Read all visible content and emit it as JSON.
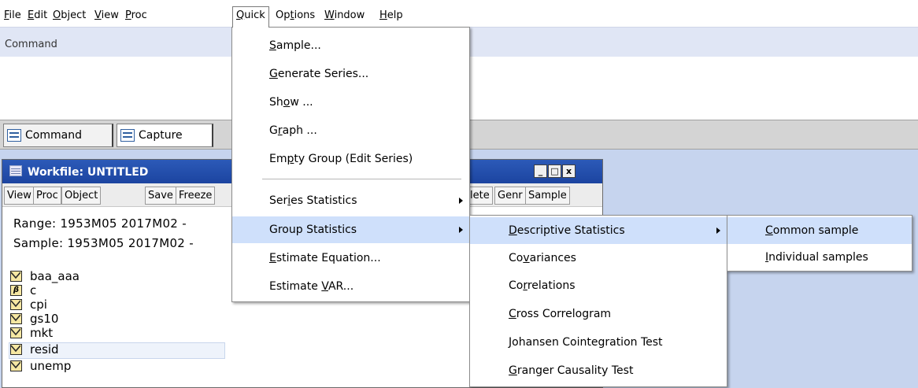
{
  "menubar": {
    "items": [
      {
        "pre": "",
        "u": "F",
        "post": "ile"
      },
      {
        "pre": "",
        "u": "E",
        "post": "dit"
      },
      {
        "pre": "",
        "u": "O",
        "post": "bject"
      },
      {
        "pre": "",
        "u": "V",
        "post": "iew"
      },
      {
        "pre": "",
        "u": "P",
        "post": "roc"
      },
      {
        "pre": "",
        "u": "Q",
        "post": "uick"
      },
      {
        "pre": "Op",
        "u": "t",
        "post": "ions"
      },
      {
        "pre": "",
        "u": "W",
        "post": "indow"
      },
      {
        "pre": "",
        "u": "H",
        "post": "elp"
      }
    ]
  },
  "command_bar": {
    "label": "Command"
  },
  "tabs": {
    "command": "Command",
    "capture": "Capture"
  },
  "workfile": {
    "title": "Workfile: UNTITLED",
    "window_buttons": {
      "minimize": "_",
      "maximize": "□",
      "close": "x"
    },
    "toolbar": [
      "View",
      "Proc",
      "Object",
      "Save",
      "Freeze"
    ],
    "toolbar_right": [
      "lete",
      "Genr",
      "Sample"
    ],
    "range": "Range:  1953M05 2017M02  -",
    "sample": "Sample: 1953M05 2017M02  -",
    "items": [
      {
        "name": "baa_aaa",
        "icon": "series-icon"
      },
      {
        "name": "c",
        "icon": "coefficient-icon"
      },
      {
        "name": "cpi",
        "icon": "series-icon"
      },
      {
        "name": "gs10",
        "icon": "series-icon"
      },
      {
        "name": "mkt",
        "icon": "series-icon"
      },
      {
        "name": "resid",
        "icon": "series-icon"
      },
      {
        "name": "unemp",
        "icon": "series-icon"
      }
    ],
    "coef_icon_glyph": "β"
  },
  "quick_menu": {
    "items": [
      {
        "pre": "",
        "u": "S",
        "post": "ample..."
      },
      {
        "pre": "",
        "u": "G",
        "post": "enerate Series..."
      },
      {
        "pre": "Sh",
        "u": "o",
        "post": "w ..."
      },
      {
        "pre": "G",
        "u": "r",
        "post": "aph ..."
      },
      {
        "pre": "Em",
        "u": "p",
        "post": "ty Group (Edit Series)"
      },
      {
        "pre": "Ser",
        "u": "i",
        "post": "es Statistics"
      },
      {
        "pre": "Group Statistics",
        "u": "",
        "post": ""
      },
      {
        "pre": "",
        "u": "E",
        "post": "stimate Equation..."
      },
      {
        "pre": "Estimate ",
        "u": "V",
        "post": "AR..."
      }
    ]
  },
  "group_stats_menu": {
    "items": [
      {
        "pre": "",
        "u": "D",
        "post": "escriptive Statistics"
      },
      {
        "pre": "Co",
        "u": "v",
        "post": "ariances"
      },
      {
        "pre": "Co",
        "u": "r",
        "post": "relations"
      },
      {
        "pre": "",
        "u": "C",
        "post": "ross Correlogram"
      },
      {
        "pre": "",
        "u": "J",
        "post": "ohansen Cointegration Test"
      },
      {
        "pre": "",
        "u": "G",
        "post": "ranger Causality Test"
      }
    ]
  },
  "descriptive_menu": {
    "items": [
      {
        "pre": "",
        "u": "C",
        "post": "ommon sample"
      },
      {
        "pre": "",
        "u": "I",
        "post": "ndividual samples"
      }
    ]
  },
  "colors": {
    "menu_highlight": "#cfe0fb",
    "titlebar": "#2c5ab8",
    "desktop": "#c6d4ee"
  }
}
